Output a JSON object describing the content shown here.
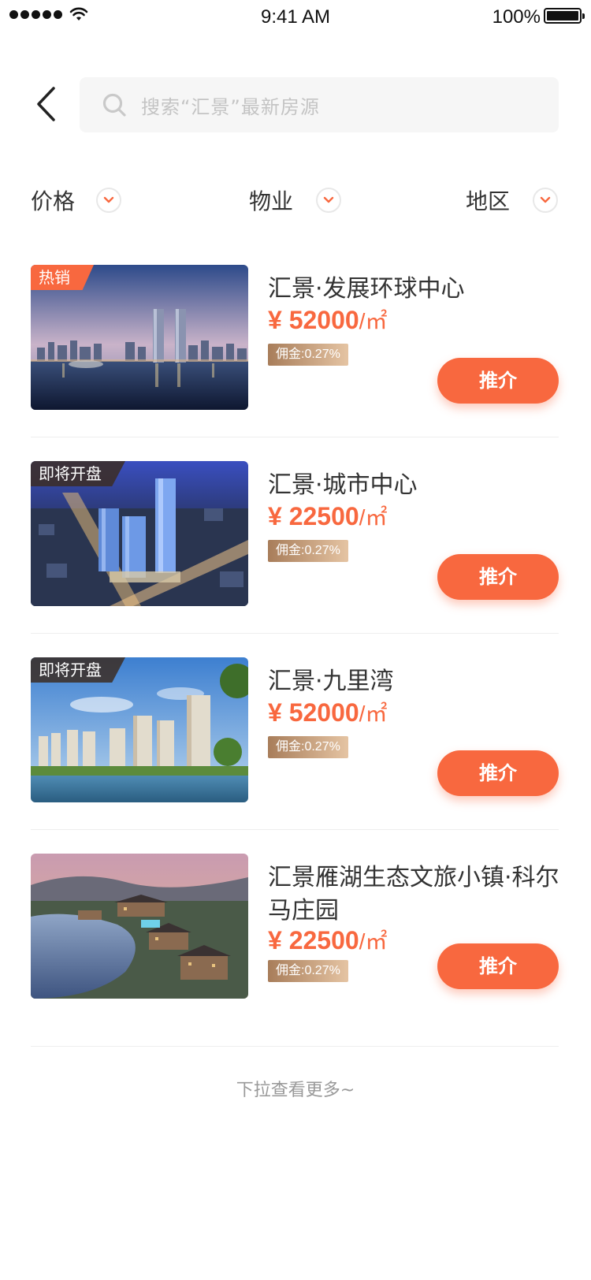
{
  "status_bar": {
    "time": "9:41 AM",
    "battery_percent": "100%",
    "battery_level": 1.0
  },
  "search": {
    "placeholder": "搜索“汇景”最新房源"
  },
  "filters": [
    {
      "label": "价格"
    },
    {
      "label": "物业"
    },
    {
      "label": "地区"
    }
  ],
  "listings": [
    {
      "tag": "热销",
      "title": "汇景·发展环球中心",
      "price": "¥ 52000",
      "unit": "/㎡",
      "commission": "佣金:0.27%",
      "button": "推介"
    },
    {
      "tag": "即将开盘",
      "title": "汇景·城市中心",
      "price": "¥ 22500",
      "unit": "/㎡",
      "commission": "佣金:0.27%",
      "button": "推介"
    },
    {
      "tag": "即将开盘",
      "title": "汇景·九里湾",
      "price": "¥ 52000",
      "unit": "/㎡",
      "commission": "佣金:0.27%",
      "button": "推介"
    },
    {
      "tag": "",
      "title": "汇景雁湖生态文旅小镇·科尔马庄园",
      "price": "¥ 22500",
      "unit": "/㎡",
      "commission": "佣金:0.27%",
      "button": "推介"
    }
  ],
  "footer": {
    "load_more": "下拉查看更多~"
  },
  "colors": {
    "accent": "#f8683f",
    "commission_from": "#a87d5a",
    "commission_to": "#e5c4a3"
  },
  "icons": {
    "back": "chevron-left-icon",
    "search": "search-icon",
    "dropdown": "chevron-down-icon"
  }
}
